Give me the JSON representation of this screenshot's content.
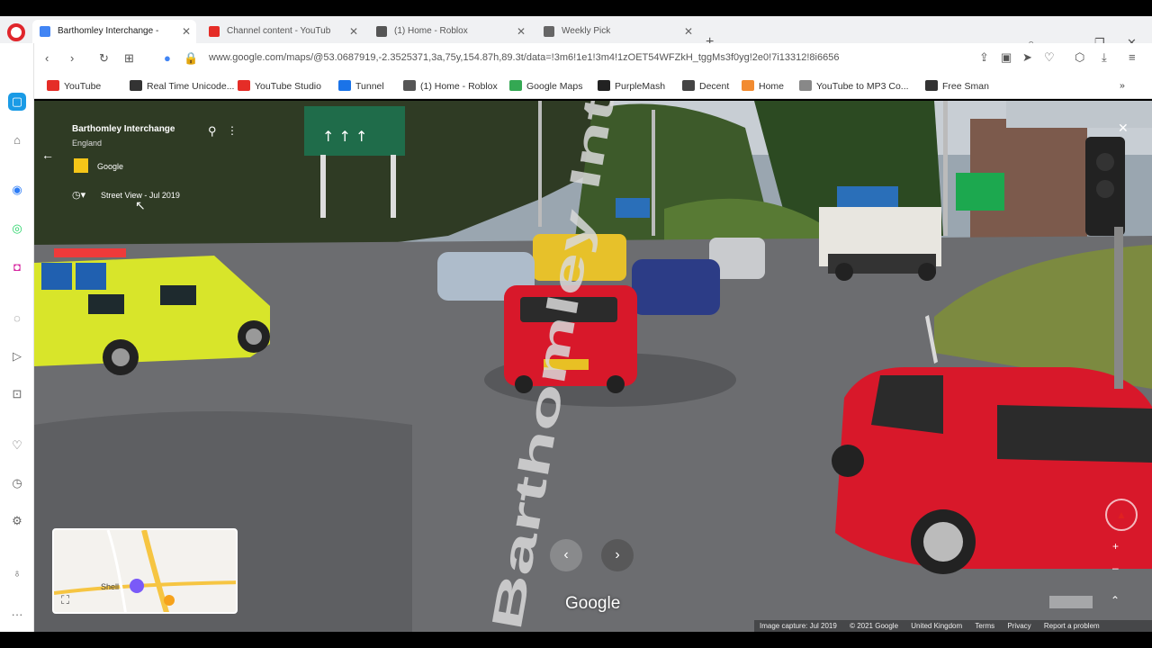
{
  "browser": {
    "tabs": [
      {
        "label": "Barthomley Interchange -",
        "active": true,
        "favicon_color": "#4285f4"
      },
      {
        "label": "Channel content - YouTub",
        "active": false,
        "favicon_color": "#e52d27"
      },
      {
        "label": "(1) Home - Roblox",
        "active": false,
        "favicon_color": "#555555"
      },
      {
        "label": "Weekly Pick",
        "active": false,
        "favicon_color": "#666666"
      }
    ],
    "url": "www.google.com/maps/@53.0687919,-2.3525371,3a,75y,154.87h,89.3t/data=!3m6!1e1!3m4!1zOET54WFZkH_tggMs3f0yg!2e0!7i13312!8i6656",
    "bookmarks": [
      {
        "label": "YouTube",
        "color": "#e52d27"
      },
      {
        "label": "Real Time Unicode...",
        "color": "#333333"
      },
      {
        "label": "YouTube Studio",
        "color": "#e52d27"
      },
      {
        "label": "Tunnel",
        "color": "#1a73e8"
      },
      {
        "label": "(1) Home - Roblox",
        "color": "#555555"
      },
      {
        "label": "Google Maps",
        "color": "#34a853"
      },
      {
        "label": "PurpleMash",
        "color": "#222222"
      },
      {
        "label": "Decent",
        "color": "#444444"
      },
      {
        "label": "Home",
        "color": "#f28b30"
      },
      {
        "label": "YouTube to MP3 Co...",
        "color": "#888888"
      },
      {
        "label": "Free Sman",
        "color": "#333333"
      }
    ]
  },
  "street_view": {
    "location_title": "Barthomley Interchange",
    "location_subtitle": "England",
    "provider": "Google",
    "date_label": "Street View - Jul 2019",
    "road_marking": "Barthomley Interchange",
    "watermark": "Google",
    "footer": [
      "Image capture: Jul 2019",
      "© 2021 Google",
      "United Kingdom",
      "Terms",
      "Privacy",
      "Report a problem"
    ],
    "minimap_label": "Shell"
  },
  "colors": {
    "accent": "#4285f4",
    "opera_red": "#e0262c",
    "police_yellow": "#d8e52a",
    "car_red": "#d8182a"
  }
}
